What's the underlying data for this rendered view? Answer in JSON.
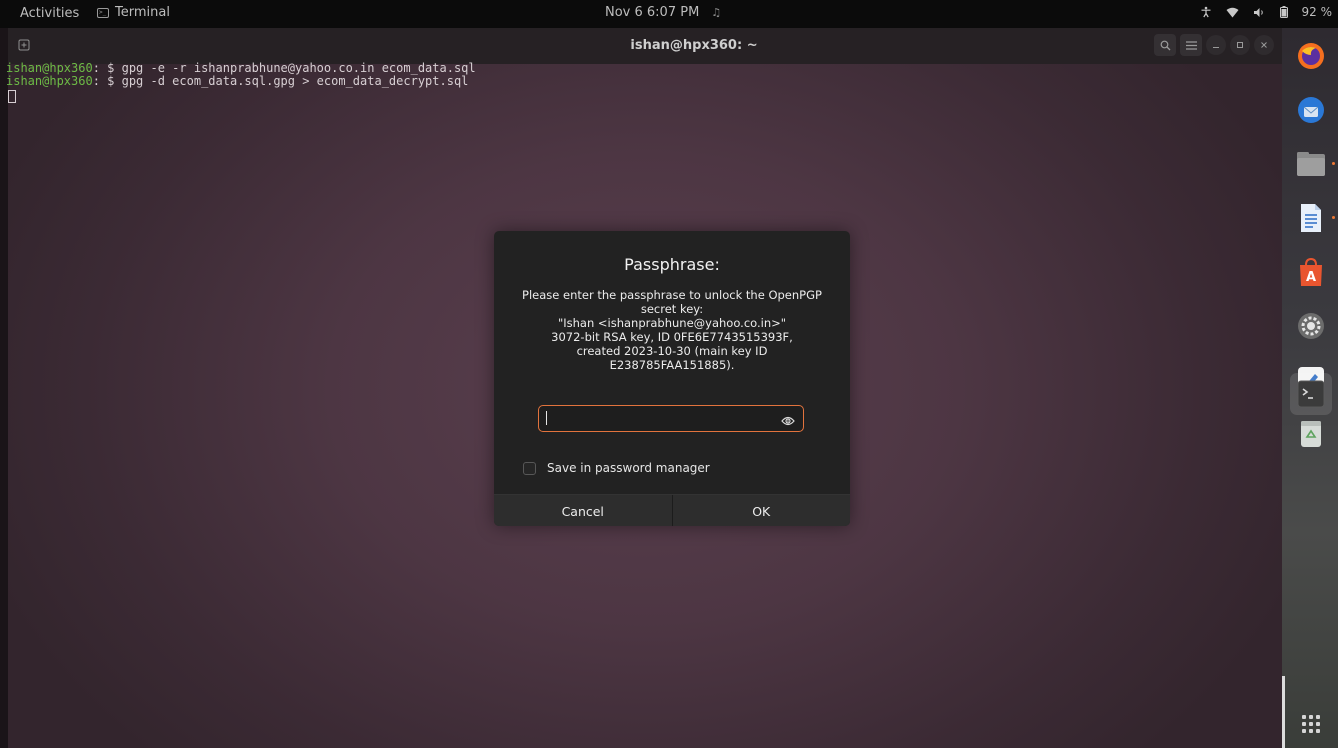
{
  "topbar": {
    "activities": "Activities",
    "app_menu": "Terminal",
    "datetime": "Nov 6  6:07 PM",
    "battery": "92 %"
  },
  "terminal": {
    "title": "ishan@hpx360: ~",
    "lines": [
      {
        "prompt": "ishan@hpx360",
        "sep": ": $ ",
        "cmd": "gpg -e -r ishanprabhune@yahoo.co.in ecom_data.sql"
      },
      {
        "prompt": "ishan@hpx360",
        "sep": ": $ ",
        "cmd": "gpg -d ecom_data.sql.gpg > ecom_data_decrypt.sql"
      }
    ]
  },
  "dialog": {
    "title": "Passphrase:",
    "message": [
      "Please enter the passphrase to unlock the OpenPGP",
      "secret key:",
      "\"Ishan <ishanprabhune@yahoo.co.in>\"",
      "3072-bit RSA key, ID 0FE6E7743515393F,",
      "created 2023-10-30 (main key ID",
      "E238785FAA151885)."
    ],
    "passphrase_value": "",
    "save_label": "Save in password manager",
    "save_checked": false,
    "cancel_label": "Cancel",
    "ok_label": "OK"
  },
  "dock": {
    "items": [
      "firefox-icon",
      "thunderbird-icon",
      "files-icon",
      "writer-icon",
      "app-center-icon",
      "settings-icon",
      "text-editor-icon",
      "terminal-icon",
      "trash-icon",
      "show-apps-icon"
    ]
  },
  "colors": {
    "accent": "#e2733d",
    "prompt": "#6dbb46",
    "dialog_bg": "#222222"
  }
}
